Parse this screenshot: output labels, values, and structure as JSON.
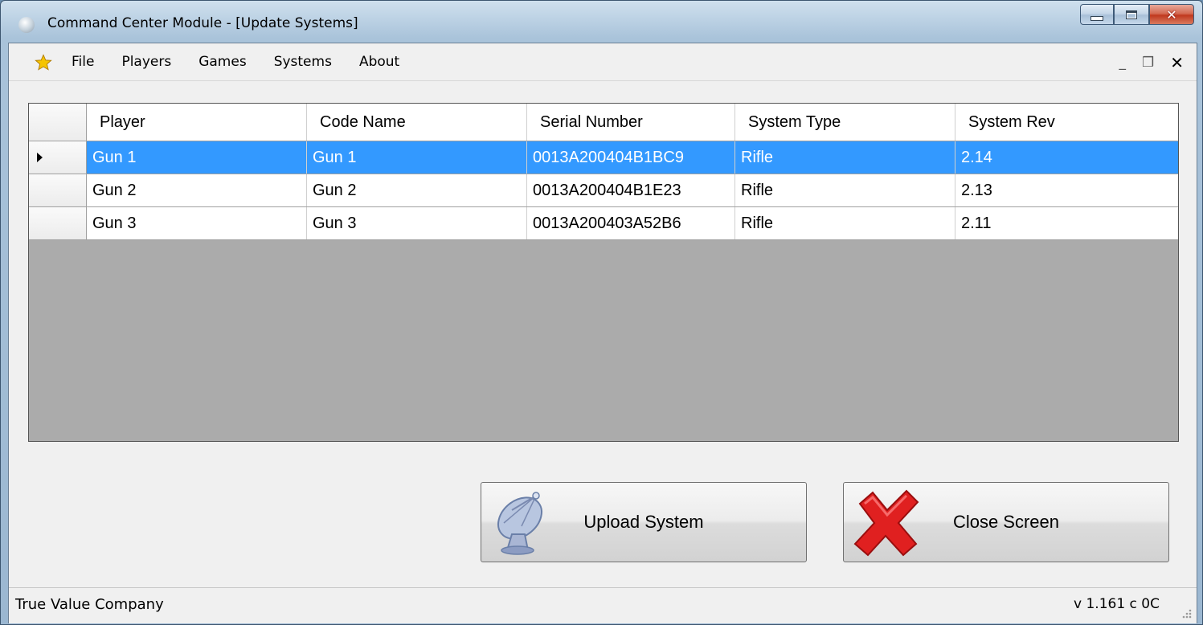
{
  "window": {
    "title": "Command Center Module - [Update Systems]"
  },
  "menu": {
    "items": [
      "File",
      "Players",
      "Games",
      "Systems",
      "About"
    ],
    "mdi_minimize": "_",
    "mdi_restore": "❒",
    "mdi_close": "✕"
  },
  "grid": {
    "columns": [
      "Player",
      "Code Name",
      "Serial Number",
      "System Type",
      "System Rev"
    ],
    "rows": [
      {
        "player": "Gun 1",
        "code_name": "Gun 1",
        "serial": "0013A200404B1BC9",
        "type": "Rifle",
        "rev": "2.14",
        "selected": true
      },
      {
        "player": "Gun 2",
        "code_name": "Gun 2",
        "serial": "0013A200404B1E23",
        "type": "Rifle",
        "rev": "2.13",
        "selected": false
      },
      {
        "player": "Gun 3",
        "code_name": "Gun 3",
        "serial": "0013A200403A52B6",
        "type": "Rifle",
        "rev": "2.11",
        "selected": false
      }
    ]
  },
  "buttons": {
    "upload_label": "Upload System",
    "close_label": "Close Screen"
  },
  "status": {
    "company": "True Value Company",
    "version": "v 1.161  c 0C"
  },
  "colors": {
    "selection": "#3399ff",
    "grid_empty": "#ababab",
    "close_x": "#e02020"
  },
  "icons": {
    "app": "satellite-dish-icon",
    "menu": "star-icon",
    "upload": "satellite-dish-icon",
    "close": "red-x-icon"
  }
}
